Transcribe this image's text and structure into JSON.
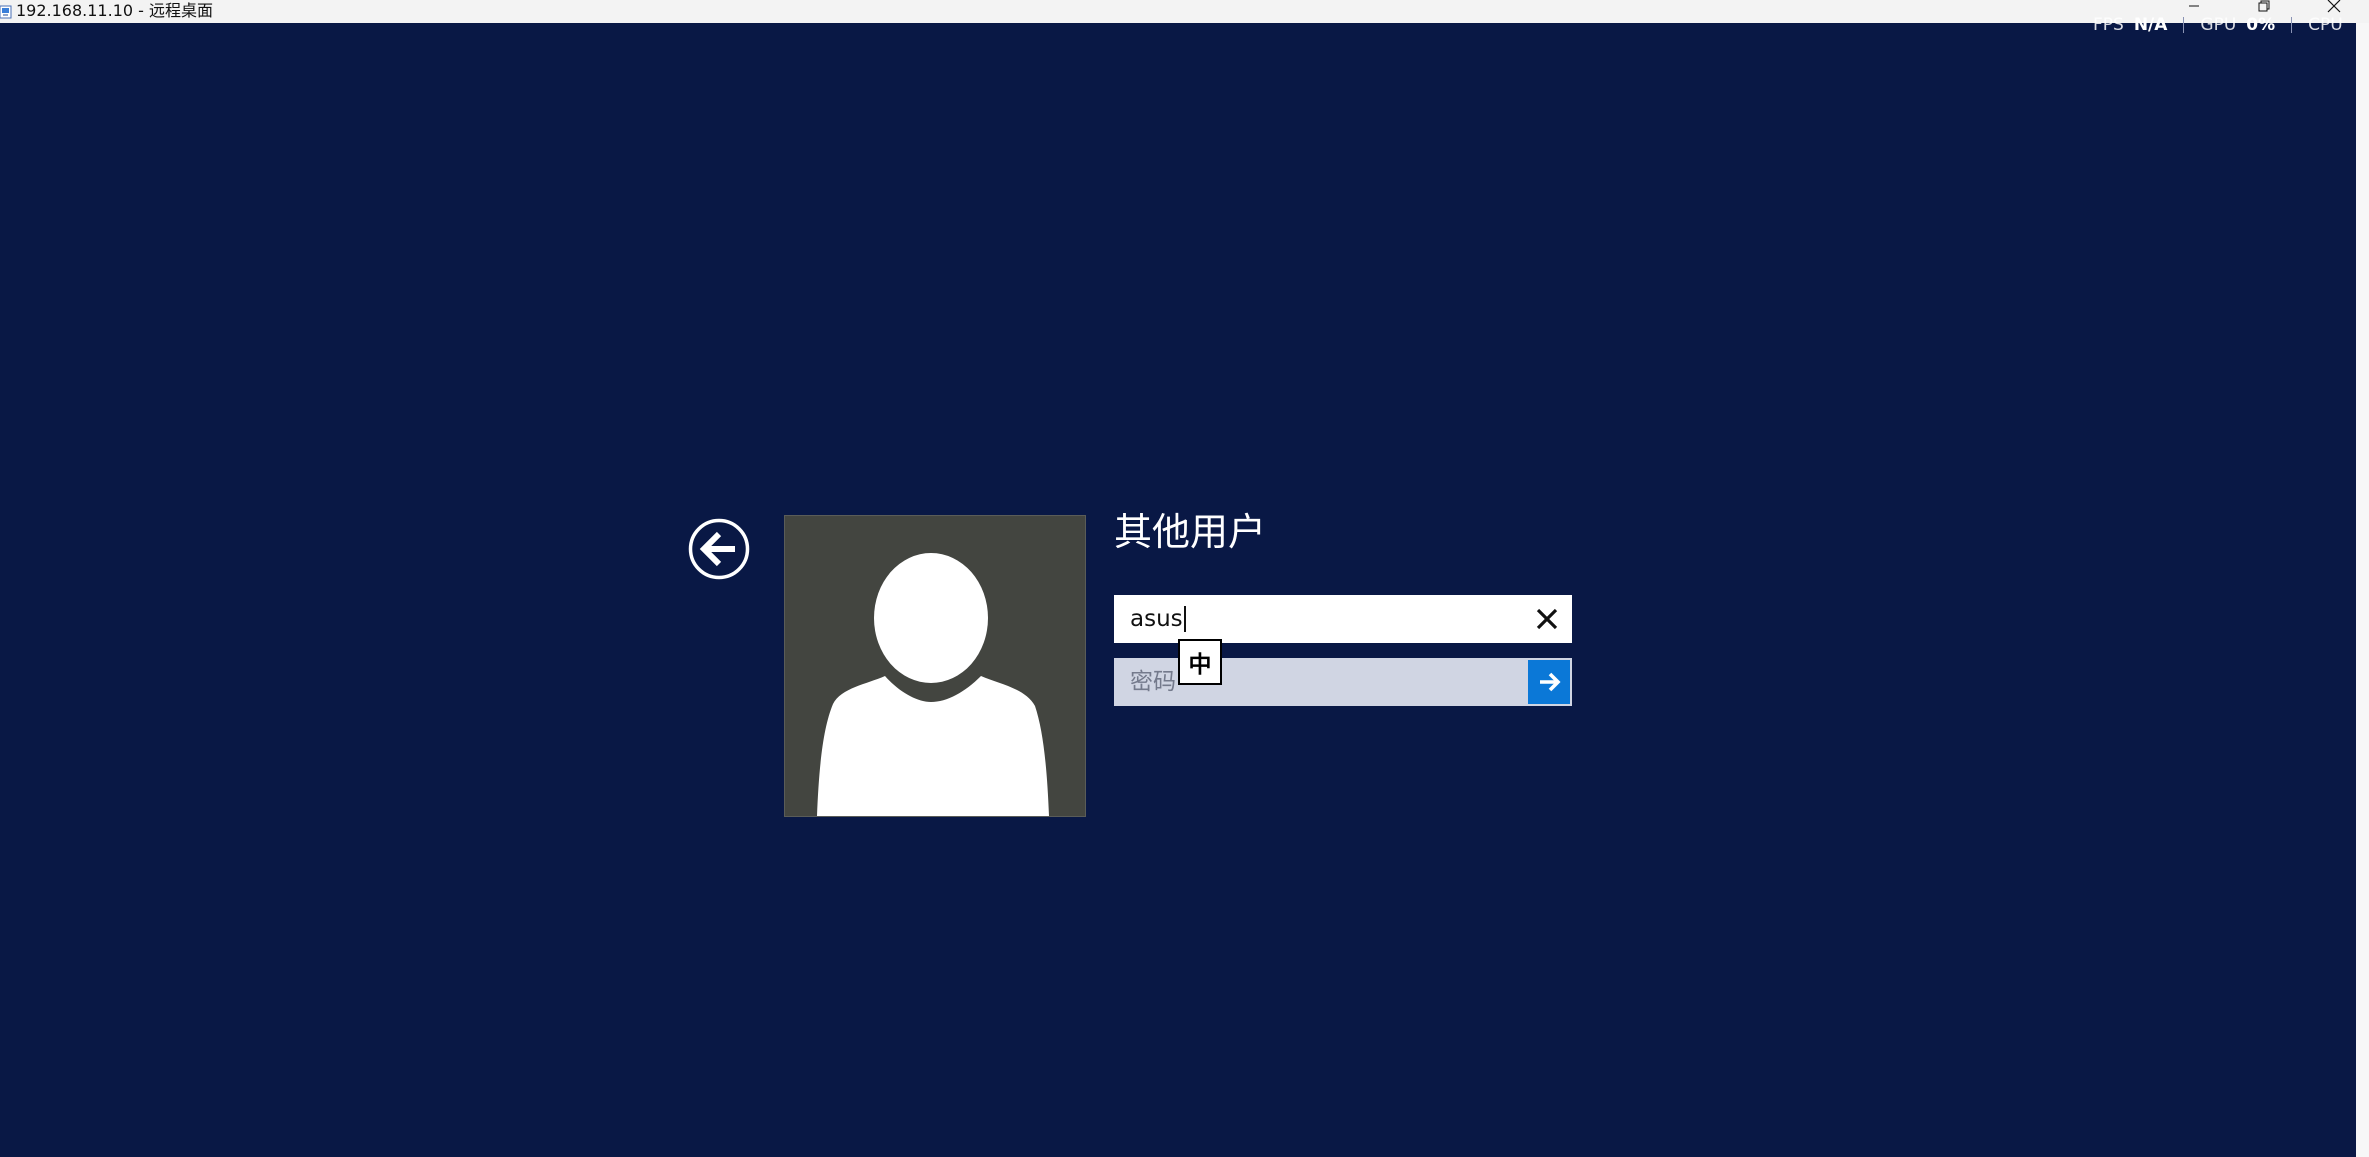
{
  "window": {
    "title": "192.168.11.10 - 远程桌面",
    "icon": "remote-desktop-icon",
    "controls": [
      "minimize-icon",
      "restore-icon",
      "close-icon"
    ]
  },
  "perf_overlay": {
    "fps_label": "FPS",
    "fps_value": "N/A",
    "gpu_label": "GPU",
    "gpu_value": "0%",
    "cpu_label": "CPU"
  },
  "login": {
    "back_icon": "back-arrow-circle-icon",
    "avatar_icon": "user-silhouette-icon",
    "title": "其他用户",
    "username": {
      "value": "asus",
      "clear_icon": "close-x-icon"
    },
    "password": {
      "placeholder": "密码",
      "value": "",
      "submit_icon": "arrow-right-icon"
    },
    "ime_mode": "中"
  },
  "colors": {
    "background": "#091845",
    "avatar_bg": "#434540",
    "password_bg": "#d0d5e3",
    "submit_blue": "#0b78d7",
    "titlebar": "#f3f3f3"
  }
}
